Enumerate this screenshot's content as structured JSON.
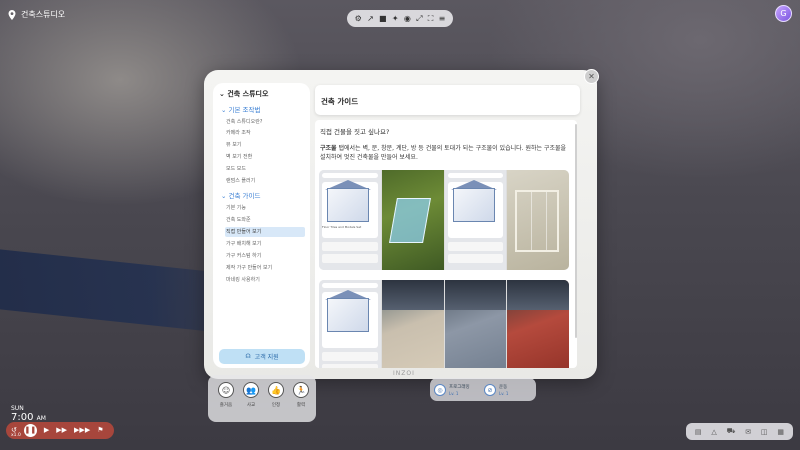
{
  "location": {
    "name": "건축스튜디오"
  },
  "top_toolbar": {
    "icons": [
      "settings-icon",
      "measure-icon",
      "video-icon",
      "satellite-icon",
      "camera-icon",
      "fullscreen-icon",
      "frame-icon",
      "menu-icon"
    ],
    "glyphs": [
      "⚙",
      "↗",
      "■",
      "✦",
      "◉",
      "⤢",
      "⛶",
      "≡"
    ]
  },
  "avatar": {
    "initial": "G"
  },
  "dialog": {
    "close_glyph": "✕",
    "bottom_label": "INZOI",
    "sidebar": {
      "title": "건축 스튜디오",
      "sections": [
        {
          "label": "기본 조작법",
          "items": [
            "건축 스튜디오란?",
            "카메라 조작",
            "뷰 보기",
            "벽 보기 전환",
            "모드 모드",
            "랜덤스 플러기"
          ]
        },
        {
          "label": "건축 가이드",
          "items": [
            "기본 기능",
            "건축 도와준",
            "직접 만들어 보기",
            "가구 배치해 보기",
            "가구 커스텀 하기",
            "제작 가구 만들어 보기",
            "마네킹 사용하기"
          ]
        }
      ],
      "active_item": "직접 만들어 보기",
      "support_label": "고객 지원"
    },
    "header_title": "건축 가이드",
    "question": "직접 건물을 짓고 싶나요?",
    "desc_bold": "구조물",
    "desc_text": " 탭에서는 벽, 문, 창문, 계단, 방 등 건물의 토대가 되는 구조물이 있습니다. 원하는 구조물을 설치하여 멋진 건축물을 만들어 보세요.",
    "ui_shot_label": "Floor Tiles and Models Set"
  },
  "lower_panel": {
    "items": [
      {
        "icon": "☺",
        "label": "즐거움"
      },
      {
        "icon": "👥",
        "label": "사교"
      },
      {
        "icon": "👍",
        "label": "인정"
      },
      {
        "icon": "🏃",
        "label": "활력"
      }
    ]
  },
  "lower_panel2": {
    "item1": "프로그래밍",
    "item1_sub": "Lv. 1",
    "item2": "운동",
    "item2_sub": "Lv. 1"
  },
  "clock": {
    "day": "SUN",
    "time": "7:00",
    "ampm": "AM",
    "speed": "x1.0",
    "controls": [
      "↺",
      "❚❚",
      "▶",
      "▶▶",
      "▶▶▶",
      "⚑"
    ]
  },
  "bottom_right": {
    "icons": [
      "book-icon",
      "chart-icon",
      "car-icon",
      "mail-icon",
      "camera-icon",
      "map-icon"
    ],
    "glyphs": [
      "▤",
      "△",
      "⛟",
      "✉",
      "◫",
      "▦"
    ]
  }
}
